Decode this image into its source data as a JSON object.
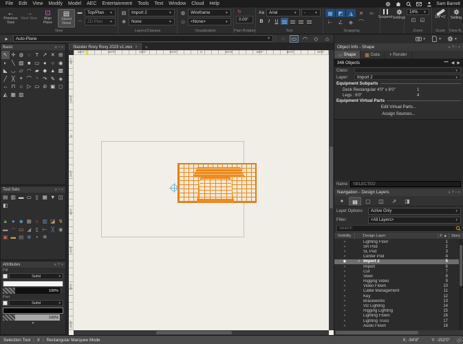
{
  "app": {
    "user": "Sam Barrett"
  },
  "menu": {
    "items": [
      "File",
      "Edit",
      "View",
      "Modify",
      "Model",
      "AEC",
      "Entertainment",
      "Tools",
      "Text",
      "Window",
      "Cloud",
      "Help"
    ]
  },
  "toolbar": {
    "previous_view": "Previous View",
    "next_view": "Next View",
    "align_plane": "Align Plane",
    "saved_views": "Saved Views",
    "view_mode": "Top/Plan",
    "view_mode_2": "2D Plan",
    "layer": "Import 2",
    "class": "None",
    "render_mode": "Wireframe",
    "render_style": "<None>",
    "plan_rotation": "0.00°",
    "font": "Arial",
    "font_size": "-",
    "bold": "B",
    "italic": "I",
    "underline": "U",
    "suspend": "Suspend",
    "settings": "Settings",
    "zoom": "14%",
    "scale": "1/4\"=1'",
    "setting": "Setting",
    "sections": {
      "view": "View",
      "layers": "Layers/Classes",
      "visualization": "Visualization",
      "rotation": "Plan Rotation",
      "text": "Text",
      "snapping": "Snapping",
      "zoom": "Zoom",
      "scale": "Scale",
      "viewbar": "View B..."
    },
    "snap_icons": [
      {
        "g": "▦",
        "on": true
      },
      {
        "g": "◩",
        "on": true
      },
      {
        "g": "◮",
        "on": true
      },
      {
        "g": "✕",
        "on": false
      },
      {
        "g": "═",
        "on": false
      }
    ],
    "snap_icons_2": [
      {
        "g": "⊢",
        "on": false
      },
      {
        "g": "∠",
        "on": false
      },
      {
        "g": "◈",
        "on": false
      },
      {
        "g": "⌒",
        "on": false
      }
    ]
  },
  "modebar": {
    "auto_plane": "Auto-Plane"
  },
  "document": {
    "tab": "Slander Roxy Roxy 2023 v1.vwx",
    "close": "×",
    "add": "+"
  },
  "canvas": {
    "h_ruler": [
      "80'0\"",
      "60'0\"",
      "40'0\"",
      "20'0\"",
      "0",
      "20'0\"",
      "40'0\"",
      "60'0\"",
      "80'0\""
    ],
    "v_ruler": [
      "40'0\"",
      "20'0\"",
      "0",
      "20'0\"",
      "40'0\"",
      "60'0\"",
      "80'0\"",
      "100'0\""
    ]
  },
  "palettes": {
    "basic": {
      "title": "Basic",
      "icons": [
        "↖",
        "✛",
        "◍",
        "◌",
        "T",
        "↗",
        "✕",
        "⊞",
        "◐",
        "╲",
        "▨",
        "■",
        "▭",
        "●",
        "○",
        "◉",
        "◣",
        "◡",
        "▱",
        "◠",
        "▰",
        "◆",
        "▲",
        "▩",
        "╱",
        "╳",
        "⌖",
        "⌒",
        "◝",
        "↷",
        "✎",
        "◈",
        "↔",
        "⊓",
        "⌂",
        "▷",
        "▭",
        "⊘",
        "▣",
        "◻",
        "◭",
        "▦",
        "▥"
      ]
    },
    "tool_sets": {
      "title": "Tool Sets",
      "icons": [
        "▤",
        "▥",
        "▬",
        "▭",
        "▯",
        "▦",
        "▼",
        "◫",
        "◧"
      ],
      "color_icons": [
        {
          "g": "▲",
          "c": "#7aa75a"
        },
        {
          "g": "●",
          "c": "#5b9bd5"
        },
        {
          "g": "◆",
          "c": "#4d8fb5"
        },
        {
          "g": "▦",
          "c": "#9a9a9a"
        },
        {
          "g": "⌂",
          "c": "#c0614f"
        },
        {
          "g": "▥",
          "c": "#6f8fc0"
        },
        {
          "g": "◪",
          "c": "#c8a06a"
        },
        {
          "g": "↯",
          "c": "#e0c050"
        },
        {
          "g": "▬",
          "c": "#9a9a9a"
        },
        {
          "g": "◠",
          "c": "#c0614f"
        },
        {
          "g": "▭",
          "c": "#c8a06a"
        },
        {
          "g": "◢",
          "c": "#8a8a8a"
        },
        {
          "g": "▯",
          "c": "#b0b0b0"
        },
        {
          "g": "⊢",
          "c": "#c8a06a"
        },
        {
          "g": "╳",
          "c": "#5b9bd5"
        },
        {
          "g": "◉",
          "c": "#9a9a9a"
        },
        {
          "g": "▣",
          "c": "#c0614f"
        },
        {
          "g": "▬",
          "c": "#c8a06a"
        },
        {
          "g": "▤",
          "c": "#8a8a8a"
        },
        {
          "g": "⊕",
          "c": "#5b9bd5"
        },
        {
          "g": "▪",
          "c": "#9a9a9a"
        },
        {
          "g": "✻",
          "c": "#9a9a9a"
        }
      ]
    },
    "attributes": {
      "title": "Attributes",
      "fill_label": "Fill",
      "fill_style": "Solid",
      "fill_opacity": "100%",
      "pen_label": "Pen",
      "pen_style": "Solid",
      "pen_opacity": "100%"
    }
  },
  "object_info": {
    "title": "Object Info - Shape",
    "tabs": [
      "Shape",
      "Data",
      "Render"
    ],
    "objects_count": "346 Objects",
    "dots": "•••",
    "class_label": "Class:",
    "class_value": "",
    "layer_label": "Layer:",
    "layer_value": "Import 2",
    "subparts_header": "Equipment Subparts",
    "subparts": [
      {
        "name": "Deck Rectangular 4'0\" x 8'0\"",
        "qty": "1"
      },
      {
        "name": "Legs : 6'0\"",
        "qty": "4"
      }
    ],
    "virtual_header": "Equipment Virtual Parts",
    "edit_virtual": "Edit Virtual Parts...",
    "assign_sources": "Assign Sources...",
    "name_label": "Name:",
    "name_value": "'SELECTED'"
  },
  "navigation": {
    "title": "Navigation - Design Layers",
    "layer_options_label": "Layer Options:",
    "layer_options": "Active Only",
    "filter_label": "Filter:",
    "filter": "<All Layers>",
    "search_placeholder": "Search",
    "columns": [
      "Visibility",
      "Design Layer",
      "#",
      "Story"
    ],
    "rows": [
      {
        "name": "Lighting Floor",
        "num": "1"
      },
      {
        "name": "SR Pod",
        "num": "2"
      },
      {
        "name": "SL Pod",
        "num": "3"
      },
      {
        "name": "Center Pod",
        "num": "4"
      },
      {
        "name": "Import 2",
        "num": "5",
        "active": true
      },
      {
        "name": "Import",
        "num": "6"
      },
      {
        "name": "Cut",
        "num": "7"
      },
      {
        "name": "Steel",
        "num": "8"
      },
      {
        "name": "Rigging Video",
        "num": "9"
      },
      {
        "name": "Video Flown",
        "num": "10"
      },
      {
        "name": "Cable Management",
        "num": "11"
      },
      {
        "name": "Key",
        "num": "12"
      },
      {
        "name": "Braceworks",
        "num": "13"
      },
      {
        "name": "Viz Lighting",
        "num": "14"
      },
      {
        "name": "Rigging Lighting",
        "num": "15"
      },
      {
        "name": "Lighting Flown",
        "num": "16"
      },
      {
        "name": "Lighting Truss",
        "num": "17"
      },
      {
        "name": "Audio Flown",
        "num": "18"
      }
    ]
  },
  "status": {
    "tool": "Selection Tool",
    "shortcut": "X",
    "mode": "Rectangular Marquee Mode",
    "x": "X: -94'8\"",
    "y": "Y: -152'0\""
  },
  "colors": {
    "accent_orange": "#f08a1d",
    "accent_blue": "#4a90d9",
    "canvas_bg": "#f0eee7"
  }
}
